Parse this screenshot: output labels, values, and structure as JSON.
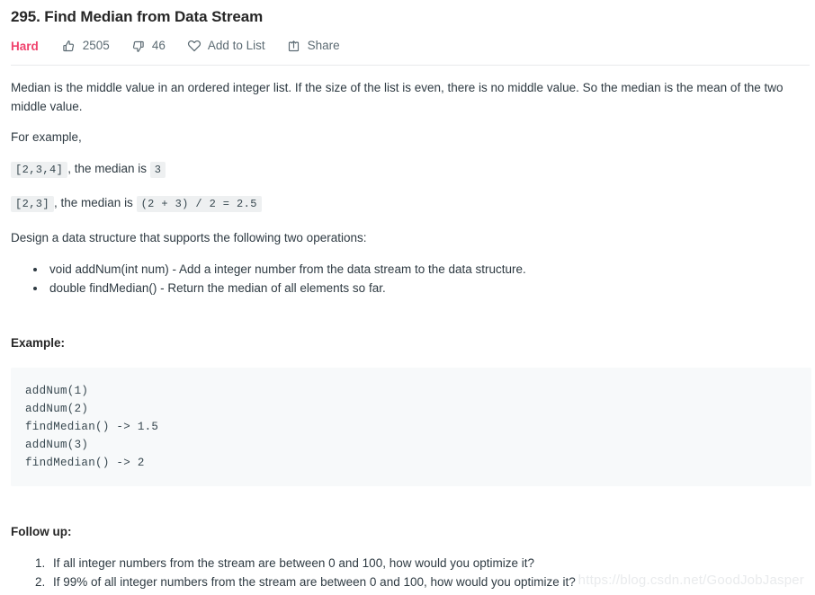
{
  "problem": {
    "title": "295. Find Median from Data Stream",
    "difficulty": "Hard",
    "likes": "2505",
    "dislikes": "46",
    "add_to_list_label": "Add to List",
    "share_label": "Share",
    "difficulty_color": "#f0436d",
    "meta_text_color": "#5c6b73"
  },
  "description": {
    "intro": "Median is the middle value in an ordered integer list. If the size of the list is even, there is no middle value. So the median is the mean of the two middle value.",
    "for_example_label": "For example,",
    "example_one": {
      "code_list": "[2,3,4]",
      "text": ", the median is",
      "code_result": "3"
    },
    "example_two": {
      "code_list": "[2,3]",
      "text": ", the median is",
      "code_result": "(2 + 3) / 2 = 2.5"
    },
    "design_line": "Design a data structure that supports the following two operations:",
    "operations": [
      "void addNum(int num) - Add a integer number from the data stream to the data structure.",
      "double findMedian() - Return the median of all elements so far."
    ]
  },
  "example_section": {
    "heading": "Example:",
    "code": "addNum(1)\naddNum(2)\nfindMedian() -> 1.5\naddNum(3)\nfindMedian() -> 2",
    "background_color": "#f7f9fa"
  },
  "followup_section": {
    "heading": "Follow up:",
    "items": [
      "If all integer numbers from the stream are between 0 and 100, how would you optimize it?",
      "If 99% of all integer numbers from the stream are between 0 and 100, how would you optimize it?"
    ]
  },
  "watermark": {
    "text": "https://blog.csdn.net/GoodJobJasper"
  }
}
